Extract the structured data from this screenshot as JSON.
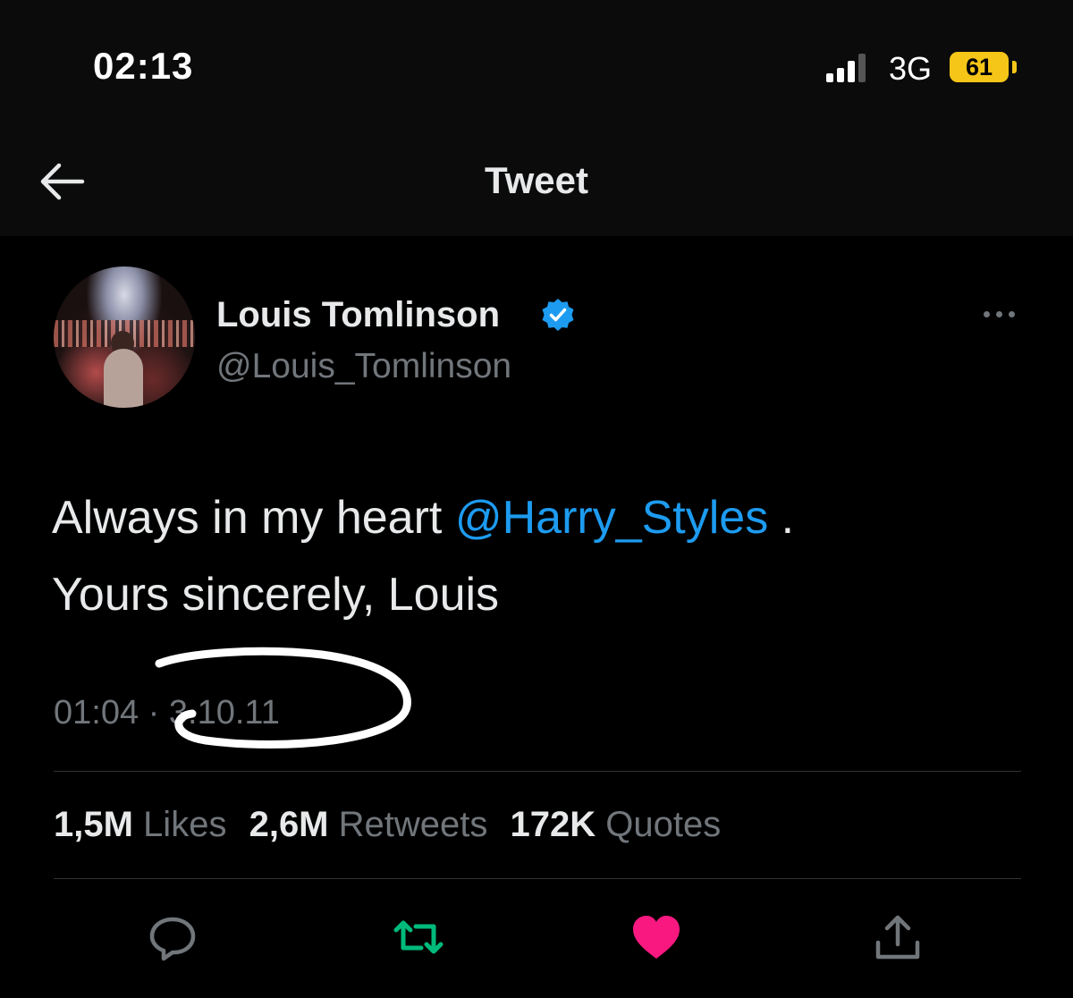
{
  "status_bar": {
    "time": "02:13",
    "network": "3G",
    "battery": "61",
    "battery_color": "#f5c518"
  },
  "nav": {
    "back_icon": "arrow-left-icon",
    "title": "Tweet"
  },
  "tweet": {
    "author_name": "Louis Tomlinson",
    "author_handle": "@Louis_Tomlinson",
    "verified_icon": "verified-badge-icon",
    "text_before": "Always in my heart ",
    "mention": "@Harry_Styles",
    "text_after": " .",
    "text_line2": "Yours sincerely, Louis",
    "time": "01:04",
    "date_separator": " · ",
    "date": "3.10.11",
    "mention_color": "#1d9bf0"
  },
  "stats": {
    "likes_count": "1,5M",
    "likes_label": "Likes",
    "retweets_count": "2,6M",
    "retweets_label": "Retweets",
    "quotes_count": "172K",
    "quotes_label": "Quotes"
  },
  "actions": {
    "reply_icon": "reply-bubble-icon",
    "retweet_icon": "retweet-icon",
    "like_icon": "heart-icon",
    "share_icon": "share-icon",
    "retweet_color": "#00ba7c",
    "like_color": "#f91880"
  }
}
